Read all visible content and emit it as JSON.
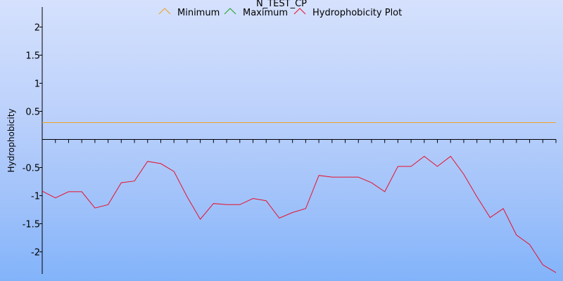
{
  "chart_data": {
    "type": "line",
    "title": "N_TEST_CP",
    "xlabel": "",
    "ylabel": "Hydrophobicity",
    "ylim": [
      -2.4,
      2.35
    ],
    "yticks": [
      2,
      1.5,
      1,
      0.5,
      -0.5,
      -1,
      -1.5,
      -2
    ],
    "legend_position": "top-center",
    "grid": false,
    "series": [
      {
        "name": "Minimum",
        "color": "#f0a020",
        "constant": 0.3
      },
      {
        "name": "Maximum",
        "color": "#20a020",
        "constant": null
      },
      {
        "name": "Hydrophobicity Plot",
        "color": "#e8102c",
        "values": [
          -0.92,
          -1.04,
          -0.93,
          -0.93,
          -1.22,
          -1.16,
          -0.77,
          -0.74,
          -0.39,
          -0.43,
          -0.57,
          -1.02,
          -1.42,
          -1.14,
          -1.16,
          -1.16,
          -1.05,
          -1.09,
          -1.4,
          -1.3,
          -1.23,
          -0.64,
          -0.67,
          -0.67,
          -0.67,
          -0.77,
          -0.93,
          -0.48,
          -0.48,
          -0.3,
          -0.48,
          -0.3,
          -0.62,
          -1.02,
          -1.39,
          -1.23,
          -1.7,
          -1.87,
          -2.23,
          -2.37
        ]
      }
    ]
  }
}
